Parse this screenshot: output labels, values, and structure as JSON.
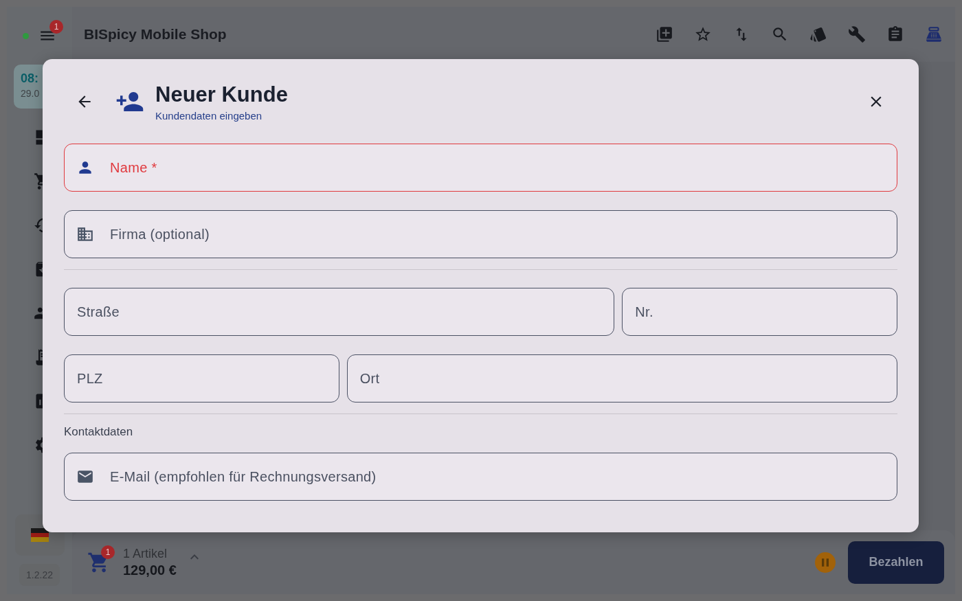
{
  "app": {
    "title": "BISpicy Mobile Shop",
    "online": true,
    "menu_badge": "1"
  },
  "sidebar": {
    "time": "08:",
    "date": "29.0",
    "version": "1.2.22"
  },
  "dialog": {
    "title": "Neuer Kunde",
    "subtitle": "Kundendaten eingeben",
    "sections": [
      {
        "rows": [
          [
            {
              "placeholder": "Name *",
              "kind": "person",
              "error": true
            }
          ],
          [
            {
              "placeholder": "Firma (optional)",
              "kind": "company",
              "error": false
            }
          ]
        ]
      },
      {
        "rows": [
          [
            {
              "placeholder": "Straße",
              "error": false
            },
            {
              "placeholder": "Nr.",
              "error": false
            }
          ],
          [
            {
              "placeholder": "PLZ",
              "error": false
            },
            {
              "placeholder": "Ort",
              "error": false
            }
          ]
        ]
      },
      {
        "heading": "Kontaktdaten",
        "rows": [
          [
            {
              "placeholder": "E-Mail (empfohlen für Rechnungsversand)",
              "kind": "email",
              "error": false
            }
          ]
        ]
      }
    ]
  },
  "cart": {
    "badge": "1",
    "count": "1 Artikel",
    "total": "129,00 €"
  },
  "pay_button": "Bezahlen"
}
